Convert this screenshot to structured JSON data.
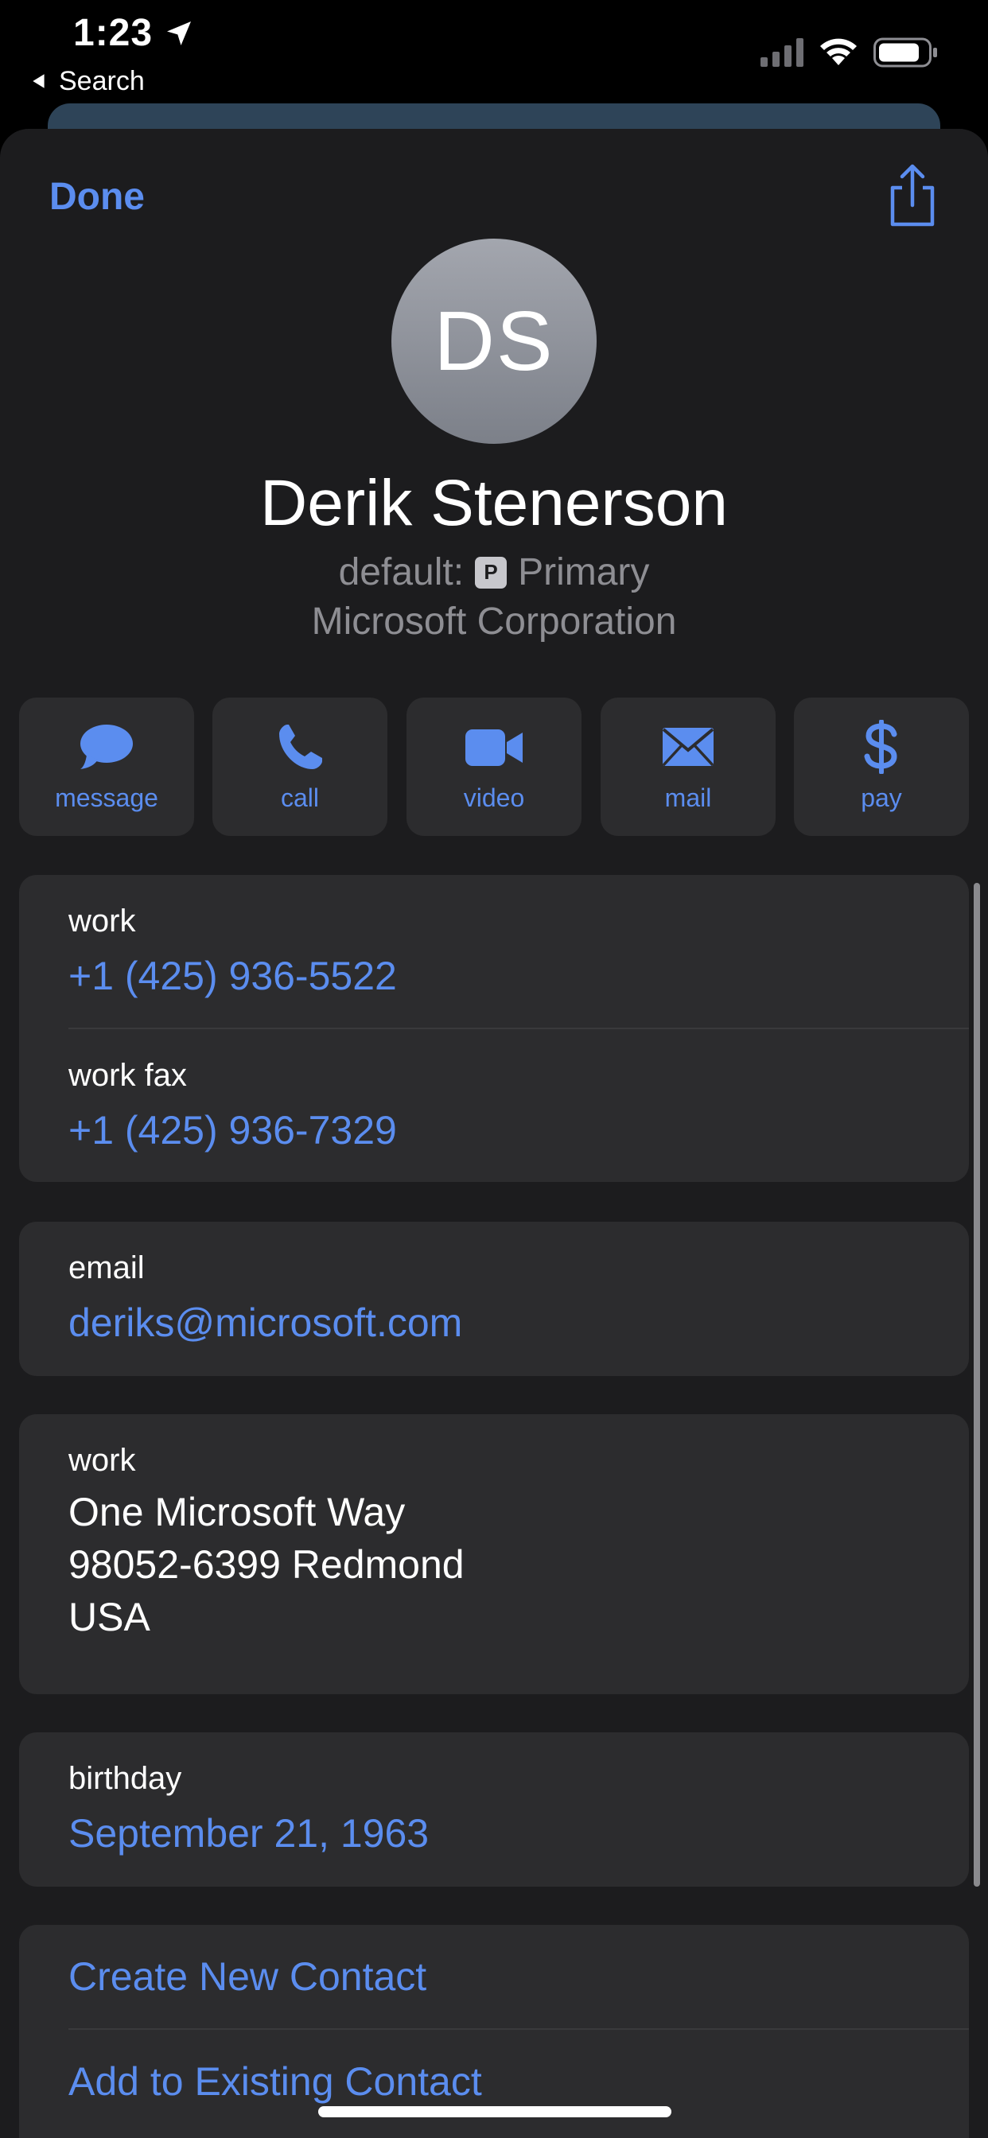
{
  "status_bar": {
    "time": "1:23",
    "back_label": "Search"
  },
  "header": {
    "done_label": "Done"
  },
  "contact": {
    "initials": "DS",
    "name": "Derik Stenerson",
    "default_prefix": "default:",
    "default_badge": "P",
    "default_value": "Primary",
    "company": "Microsoft Corporation"
  },
  "actions": [
    {
      "label": "message",
      "icon": "message-bubble-icon"
    },
    {
      "label": "call",
      "icon": "phone-icon"
    },
    {
      "label": "video",
      "icon": "video-camera-icon"
    },
    {
      "label": "mail",
      "icon": "envelope-icon"
    },
    {
      "label": "pay",
      "icon": "dollar-icon"
    }
  ],
  "phones": [
    {
      "label": "work",
      "value": "+1 (425) 936-5522"
    },
    {
      "label": "work fax",
      "value": "+1 (425) 936-7329"
    }
  ],
  "email": {
    "label": "email",
    "value": "deriks@microsoft.com"
  },
  "address": {
    "label": "work",
    "line1": "One Microsoft Way",
    "line2": "98052-6399 Redmond",
    "line3": "USA"
  },
  "birthday": {
    "label": "birthday",
    "value": "September 21, 1963"
  },
  "links": {
    "create_new": "Create New Contact",
    "add_existing": "Add to Existing Contact"
  },
  "colors": {
    "accent": "#5b8def",
    "background": "#000000",
    "sheet": "#1c1c1e",
    "card": "#2c2c2e",
    "secondary_text": "#8e8e93"
  }
}
